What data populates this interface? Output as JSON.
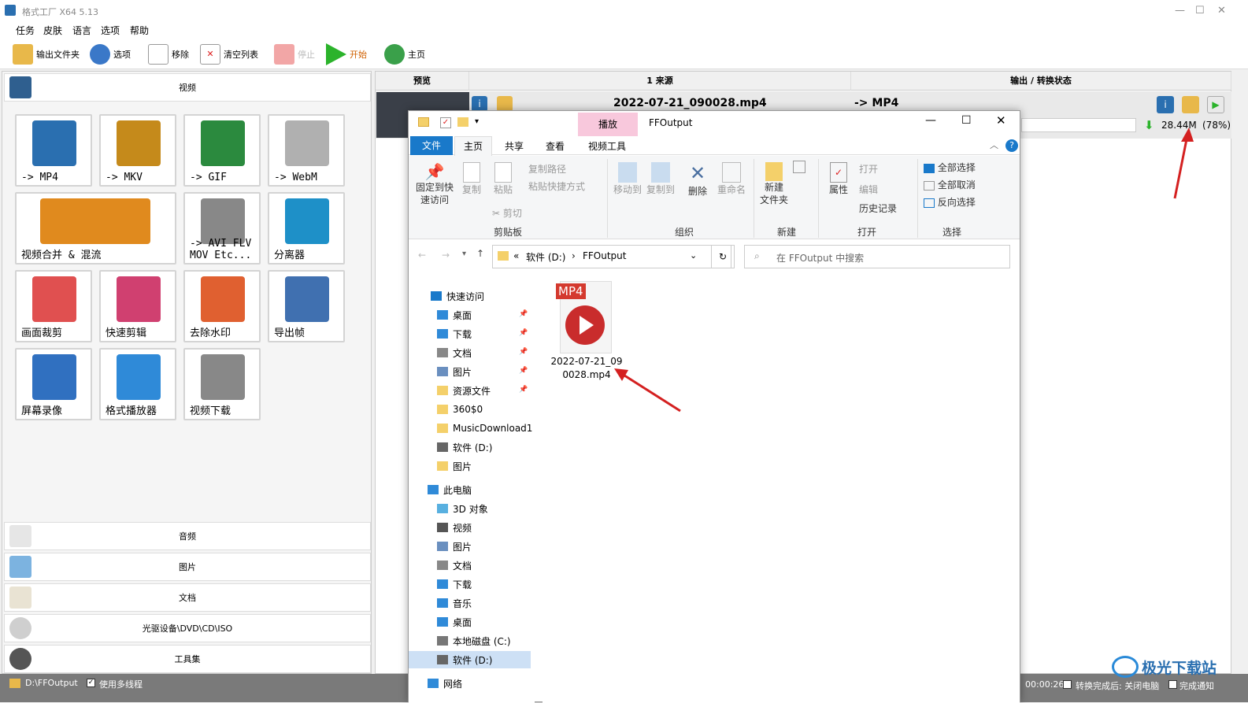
{
  "app": {
    "title": "格式工厂 X64 5.13",
    "window_controls": [
      "—",
      "☐",
      "✕"
    ]
  },
  "menu": [
    "任务",
    "皮肤",
    "语言",
    "选项",
    "帮助"
  ],
  "toolbar": {
    "output_folder": "输出文件夹",
    "options": "选项",
    "remove": "移除",
    "clear": "清空列表",
    "stop": "停止",
    "start": "开始",
    "home": "主页"
  },
  "left": {
    "video": "视频",
    "tiles": [
      {
        "label": "-> MP4",
        "icon": "mp4-icon",
        "color": "#2a6fb0"
      },
      {
        "label": "-> MKV",
        "icon": "mkv-icon",
        "color": "#c58a1b"
      },
      {
        "label": "-> GIF",
        "icon": "gif-icon",
        "color": "#2b8a3e"
      },
      {
        "label": "-> WebM",
        "icon": "webm-icon",
        "color": "#b0b0b0"
      },
      {
        "label": "视频合并 & 混流",
        "icon": "merge-icon",
        "color": "#e08a1e"
      },
      {
        "label": "-> AVI FLV\nMOV Etc...",
        "icon": "formats-icon",
        "color": "#888888"
      },
      {
        "label": "分离器",
        "icon": "splitter-icon",
        "color": "#1e90c8"
      },
      {
        "label": "画面裁剪",
        "icon": "crop-icon",
        "color": "#e05050"
      },
      {
        "label": "快速剪辑",
        "icon": "quick-cut-icon",
        "color": "#d04070"
      },
      {
        "label": "去除水印",
        "icon": "eraser-icon",
        "color": "#e06030"
      },
      {
        "label": "导出帧",
        "icon": "frames-icon",
        "color": "#4070b0"
      },
      {
        "label": "屏幕录像",
        "icon": "screen-record-icon",
        "color": "#3070c0"
      },
      {
        "label": "格式播放器",
        "icon": "player-icon",
        "color": "#2f8ad8"
      },
      {
        "label": "视频下载",
        "icon": "download-icon",
        "color": "#888888"
      }
    ],
    "audio": "音频",
    "picture": "图片",
    "document": "文档",
    "rom": "光驱设备\\DVD\\CD\\ISO",
    "tools": "工具集"
  },
  "task": {
    "col_preview": "预览",
    "col_source": "1 来源",
    "col_status": "输出 / 转换状态",
    "file": "2022-07-21_090028.mp4",
    "target": "-> MP4",
    "size": "28.44M",
    "percent": "(78%)",
    "progress": 0.78
  },
  "status": {
    "output_path": "D:\\FFOutput",
    "multithread": "使用多线程",
    "elapsed": "00:00:26",
    "right_a": "转换完成后: 关闭电脑",
    "right_b": "完成通知"
  },
  "explorer": {
    "title": "FFOutput",
    "play_tab": "播放",
    "tabs": [
      "文件",
      "主页",
      "共享",
      "查看",
      "视频工具"
    ],
    "ribbon": {
      "pin": "固定到快\n速访问",
      "copy": "复制",
      "paste": "粘贴",
      "copy_path": "复制路径",
      "paste_shortcut": "粘贴快捷方式",
      "cut": "剪切",
      "clipboard": "剪贴板",
      "move_to": "移动到",
      "copy_to": "复制到",
      "delete": "删除",
      "rename": "重命名",
      "organize": "组织",
      "new_folder": "新建\n文件夹",
      "new": "新建",
      "properties": "属性",
      "open": "打开",
      "edit": "编辑",
      "history": "历史记录",
      "open_group": "打开",
      "select_all": "全部选择",
      "select_none": "全部取消",
      "invert": "反向选择",
      "select_group": "选择"
    },
    "crumbs": [
      "«",
      "软件 (D:)",
      "›",
      "FFOutput"
    ],
    "search_placeholder": "在 FFOutput 中搜索",
    "nav": [
      "快速访问",
      "桌面",
      "下载",
      "文档",
      "图片",
      "资源文件",
      "360$0",
      "MusicDownload1",
      "软件 (D:)",
      "图片",
      "此电脑",
      "3D 对象",
      "视频",
      "图片",
      "文档",
      "下载",
      "音乐",
      "桌面",
      "本地磁盘 (C:)",
      "软件 (D:)",
      "网络"
    ],
    "file": {
      "name": "2022-07-21_090028.mp4",
      "badge": "MP4"
    }
  },
  "watermark": "极光下载站"
}
